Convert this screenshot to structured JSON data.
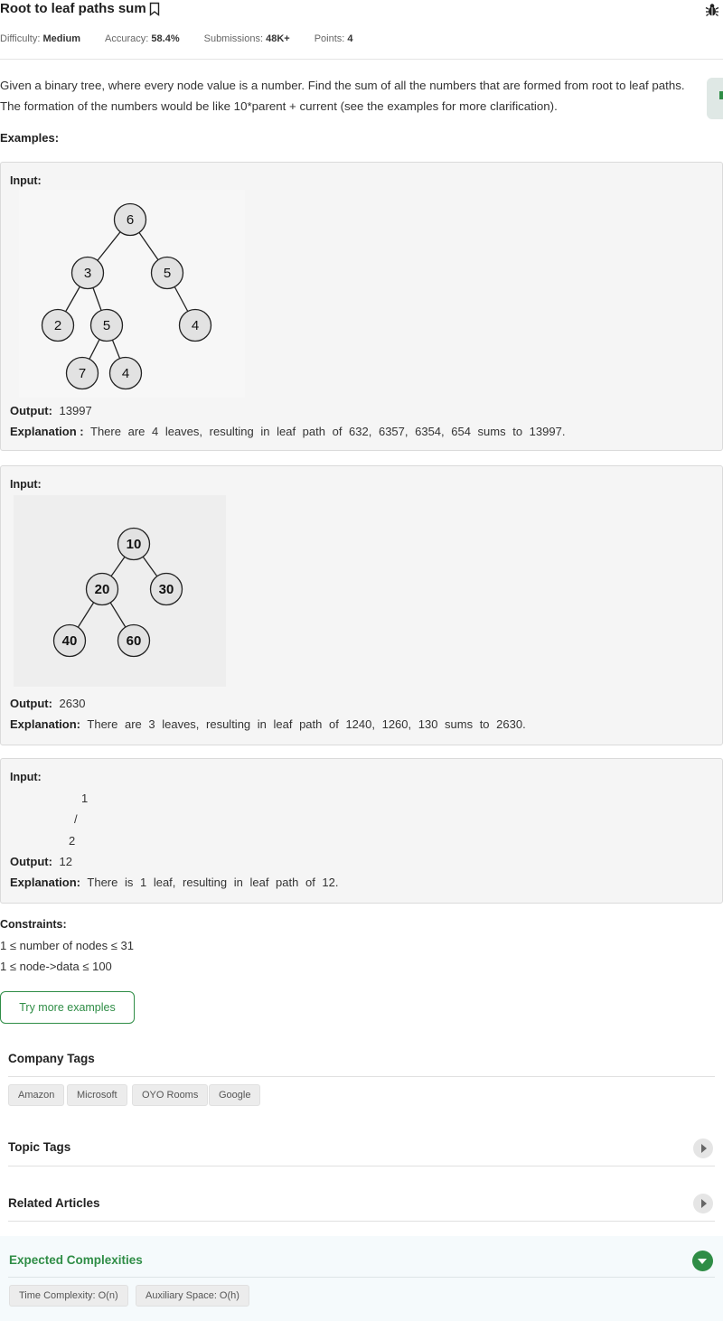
{
  "problem": {
    "title": "Root to leaf paths sum",
    "meta": {
      "difficulty_label": "Difficulty:",
      "difficulty": "Medium",
      "accuracy_label": "Accuracy:",
      "accuracy": "58.4%",
      "submissions_label": "Submissions:",
      "submissions": "48K+",
      "points_label": "Points:",
      "points": "4"
    },
    "description_1": "Given a binary tree, where every node value is a number. Find the sum of all the numbers that are formed from root to leaf paths.",
    "description_2": "The formation of the numbers would be like 10*parent + current (see the examples for more clarification).",
    "examples_label": "Examples:"
  },
  "examples": [
    {
      "input_label": "Input:",
      "tree_nodes": [
        "6",
        "3",
        "5",
        "2",
        "5",
        "4",
        "7",
        "4"
      ],
      "output_label": "Output:",
      "output": "13997",
      "explanation_label": "Explanation :",
      "explanation": "There are 4 leaves, resulting in leaf path of 632, 6357, 6354, 654 sums to 13997."
    },
    {
      "input_label": "Input:",
      "tree_nodes": [
        "10",
        "20",
        "30",
        "40",
        "60"
      ],
      "output_label": "Output:",
      "output": "2630",
      "explanation_label": "Explanation:",
      "explanation": "There are 3 leaves, resulting in leaf path of 1240, 1260, 130 sums to 2630."
    },
    {
      "input_label": "Input:",
      "tree_lines": [
        "1",
        "/",
        "2"
      ],
      "output_label": "Output:",
      "output": "12",
      "explanation_label": "Explanation:",
      "explanation": "There is 1 leaf, resulting in leaf path of 12."
    }
  ],
  "constraints": {
    "title": "Constraints:",
    "lines": [
      "1 ≤ number of nodes ≤ 31",
      "1 ≤ node->data ≤ 100"
    ]
  },
  "try_more_label": "Try more examples",
  "company_tags": {
    "title": "Company Tags",
    "tags": [
      "Amazon",
      "Microsoft",
      "OYO Rooms",
      "Google"
    ]
  },
  "topic_tags": {
    "title": "Topic Tags"
  },
  "related_articles": {
    "title": "Related Articles"
  },
  "expected_complexities": {
    "title": "Expected Complexities",
    "tags": [
      "Time Complexity: O(n)",
      "Auxiliary Space: O(h)"
    ]
  },
  "colors": {
    "accent": "#2f8d46",
    "node_fill": "#e2e2e2",
    "panel_bg": "#f5f5f5"
  }
}
